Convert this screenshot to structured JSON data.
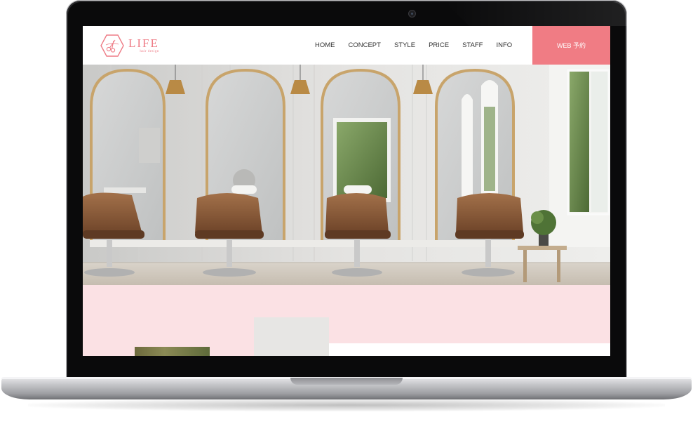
{
  "site": {
    "logo": {
      "name": "LIFE",
      "subtitle": "hair design",
      "color": "#ee7c86"
    },
    "nav": [
      {
        "label": "HOME"
      },
      {
        "label": "CONCEPT"
      },
      {
        "label": "STYLE"
      },
      {
        "label": "PRICE"
      },
      {
        "label": "STAFF"
      },
      {
        "label": "INFO"
      }
    ],
    "cta": {
      "label": "WEB 予約",
      "color": "#f07c84"
    },
    "hero": {
      "image": "salon-interior-with-arched-gold-mirrors-and-brown-leather-chairs"
    },
    "section_bg": "#fbe1e4"
  },
  "device": {
    "type": "laptop",
    "icons": [
      "camera-icon"
    ]
  }
}
